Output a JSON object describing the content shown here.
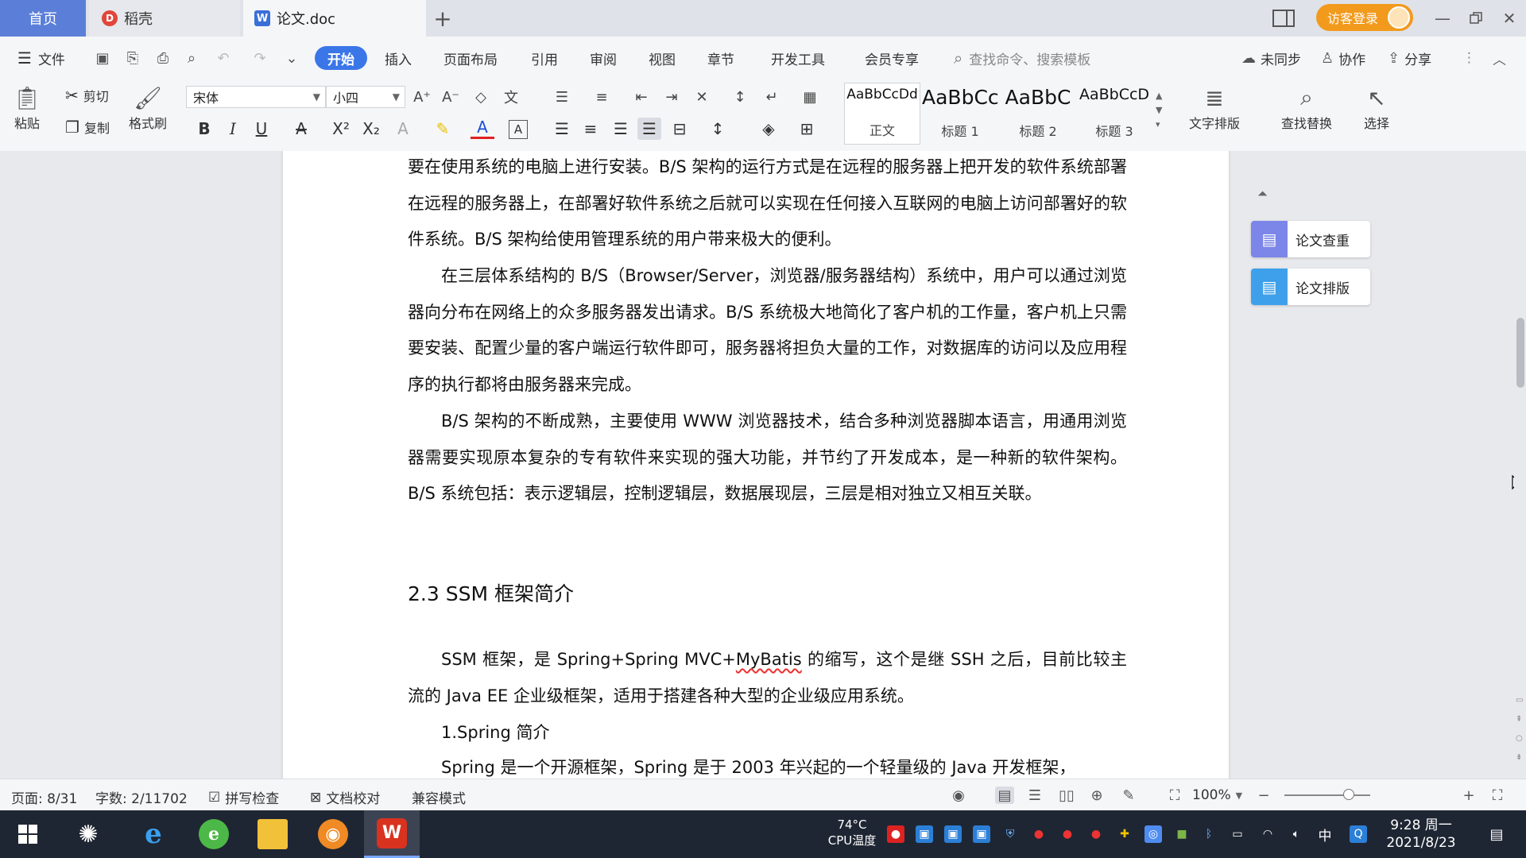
{
  "tabs": {
    "home": "首页",
    "daoke": "稻壳",
    "doc": "论文.doc",
    "login": "访客登录"
  },
  "menu": {
    "file": "文件",
    "items": [
      "开始",
      "插入",
      "页面布局",
      "引用",
      "审阅",
      "视图",
      "章节",
      "开发工具",
      "会员专享"
    ],
    "search_placeholder": "查找命令、搜索模板",
    "unsynced": "未同步",
    "collaborate": "协作",
    "share": "分享"
  },
  "ribbon": {
    "paste": "粘贴",
    "cut": "剪切",
    "copy": "复制",
    "format_painter": "格式刷",
    "font_name": "宋体",
    "font_size": "小四",
    "styles": [
      {
        "preview": "AaBbCcDd",
        "name": "正文"
      },
      {
        "preview": "AaBbCc",
        "name": "标题 1"
      },
      {
        "preview": "AaBbC",
        "name": "标题 2"
      },
      {
        "preview": "AaBbCcD",
        "name": "标题 3"
      }
    ],
    "text_layout": "文字排版",
    "find_replace": "查找替换",
    "select": "选择"
  },
  "document": {
    "paragraphs": [
      "要在使用系统的电脑上进行安装。B/S 架构的运行方式是在远程的服务器上把开发的软件系统部署在远程的服务器上，在部署好软件系统之后就可以实现在任何接入互联网的电脑上访问部署好的软件系统。B/S 架构给使用管理系统的用户带来极大的便利。",
      "在三层体系结构的 B/S（Browser/Server，浏览器/服务器结构）系统中，用户可以通过浏览器向分布在网络上的众多服务器发出请求。B/S 系统极大地简化了客户机的工作量，客户机上只需要安装、配置少量的客户端运行软件即可，服务器将担负大量的工作，对数据库的访问以及应用程序的执行都将由服务器来完成。",
      "B/S 架构的不断成熟，主要使用 WWW 浏览器技术，结合多种浏览器脚本语言，用通用浏览器需要实现原本复杂的专有软件来实现的强大功能，并节约了开发成本，是一种新的软件架构。B/S 系统包括：表示逻辑层，控制逻辑层，数据展现层，三层是相对独立又相互关联。"
    ],
    "heading": "2.3 SSM 框架简介",
    "ssm_para_before": "SSM 框架，是 Spring+Spring MVC+",
    "ssm_para_misspell": "MyBatis",
    "ssm_para_after": " 的缩写，这个是继 SSH 之后，目前比较主流的 Java EE 企业级框架，适用于搭建各种大型的企业级应用系统。",
    "sub_heading": "1.Spring 简介",
    "spring_para": "Spring 是一个开源框架，Spring 是于 2003 年兴起的一个轻量级的 Java 开发框架，"
  },
  "side_panel": {
    "check": "论文查重",
    "layout": "论文排版"
  },
  "status": {
    "page": "页面: 8/31",
    "words": "字数: 2/11702",
    "spell_check": "拼写检查",
    "proofread": "文档校对",
    "compat": "兼容模式",
    "zoom": "100%",
    "zoom_level_fraction": 0.75
  },
  "taskbar": {
    "cpu_line1": "74°C",
    "cpu_line2": "CPU温度",
    "time": "9:28 周一",
    "date": "2021/8/23",
    "ime": "中"
  },
  "colors": {
    "accent": "#3a76e8",
    "home_tab": "#5b7fd8",
    "login": "#f29a1c",
    "taskbar": "#1f2633"
  }
}
